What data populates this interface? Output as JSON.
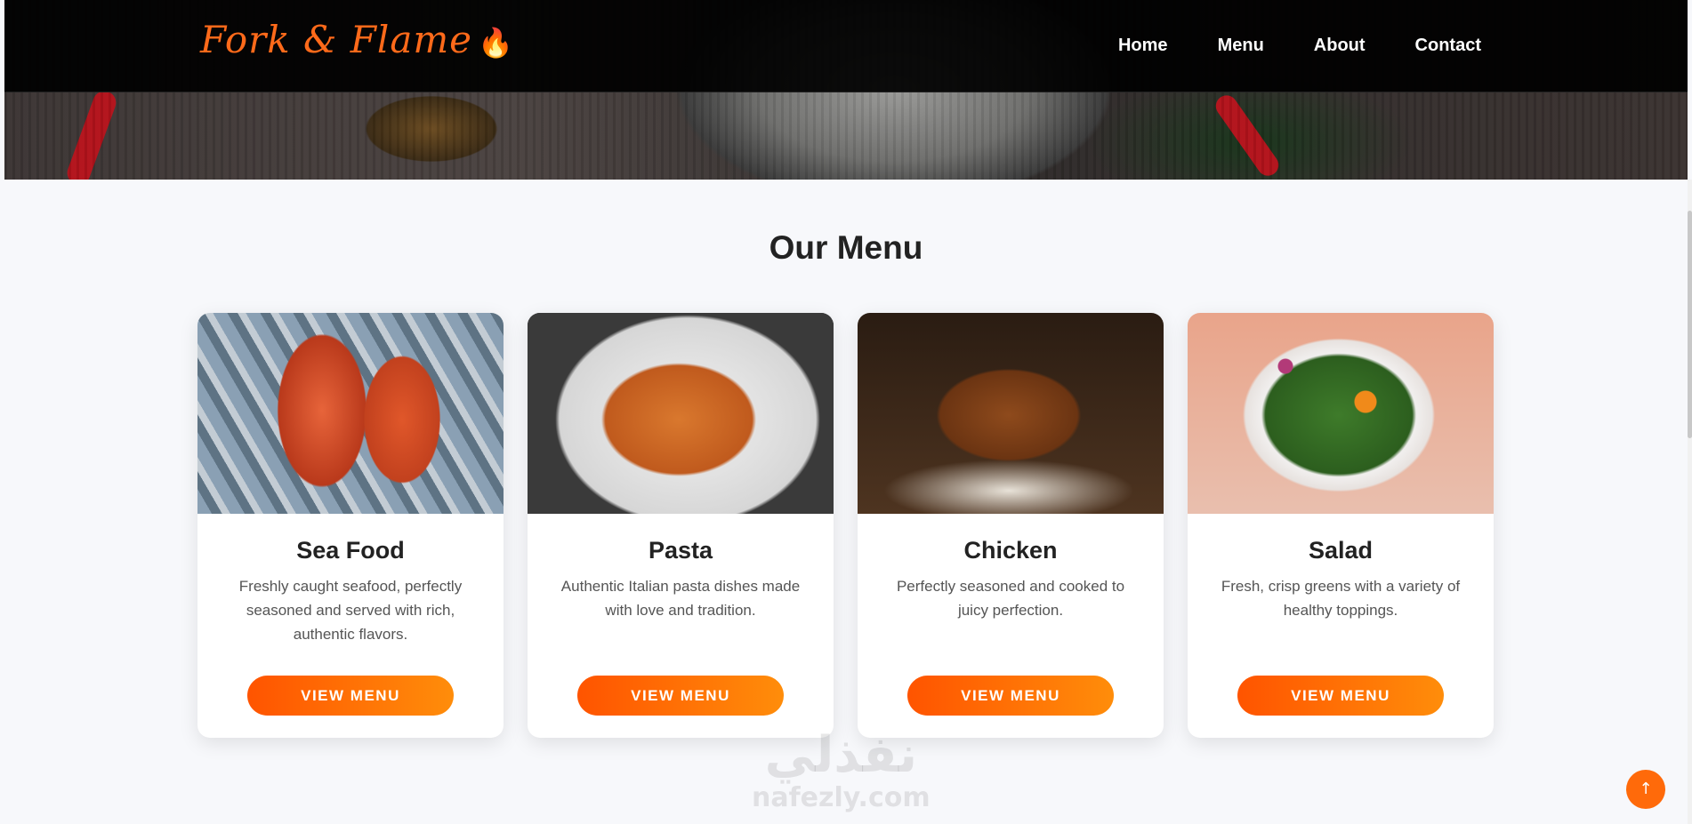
{
  "brand": {
    "name": "Fork & Flame",
    "flame_glyph": "🔥"
  },
  "nav": {
    "items": [
      "Home",
      "Menu",
      "About",
      "Contact"
    ]
  },
  "menu": {
    "title": "Our Menu",
    "cards": [
      {
        "title": "Sea Food",
        "description": "Freshly caught seafood, perfectly seasoned and served with rich, authentic flavors.",
        "button": "VIEW MENU"
      },
      {
        "title": "Pasta",
        "description": "Authentic Italian pasta dishes made with love and tradition.",
        "button": "VIEW MENU"
      },
      {
        "title": "Chicken",
        "description": "Perfectly seasoned and cooked to juicy perfection.",
        "button": "VIEW MENU"
      },
      {
        "title": "Salad",
        "description": "Fresh, crisp greens with a variety of healthy toppings.",
        "button": "VIEW MENU"
      }
    ]
  },
  "watermark": {
    "arabic": "نفذلي",
    "latin": "nafezly.com"
  },
  "scroll_top": {
    "glyph": "↑"
  },
  "colors": {
    "accent": "#ff6a1a",
    "button_start": "#ff5400",
    "button_end": "#ff8d0a",
    "nav_bg": "#000000"
  }
}
